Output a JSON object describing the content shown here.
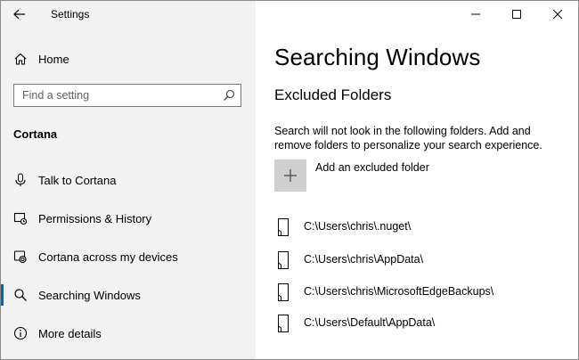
{
  "app": {
    "title": "Settings"
  },
  "sidebar": {
    "home_label": "Home",
    "search_placeholder": "Find a setting",
    "section_heading": "Cortana",
    "items": [
      {
        "label": "Talk to Cortana",
        "icon": "microphone-icon",
        "selected": false
      },
      {
        "label": "Permissions & History",
        "icon": "permissions-icon",
        "selected": false
      },
      {
        "label": "Cortana across my devices",
        "icon": "devices-icon",
        "selected": false
      },
      {
        "label": "Searching Windows",
        "icon": "search-icon",
        "selected": true
      },
      {
        "label": "More details",
        "icon": "info-icon",
        "selected": false
      }
    ]
  },
  "main": {
    "page_title": "Searching Windows",
    "subtitle": "Excluded Folders",
    "description": "Search will not look in the following folders. Add and remove folders to personalize your search experience.",
    "add_label": "Add an excluded folder",
    "folders": [
      "C:\\Users\\chris\\.nuget\\",
      "C:\\Users\\chris\\AppData\\",
      "C:\\Users\\chris\\MicrosoftEdgeBackups\\",
      "C:\\Users\\Default\\AppData\\"
    ]
  },
  "colors": {
    "sidebar_bg": "#f2f2f2",
    "accent": "#0067c0",
    "add_tile": "#cfcfcf"
  }
}
